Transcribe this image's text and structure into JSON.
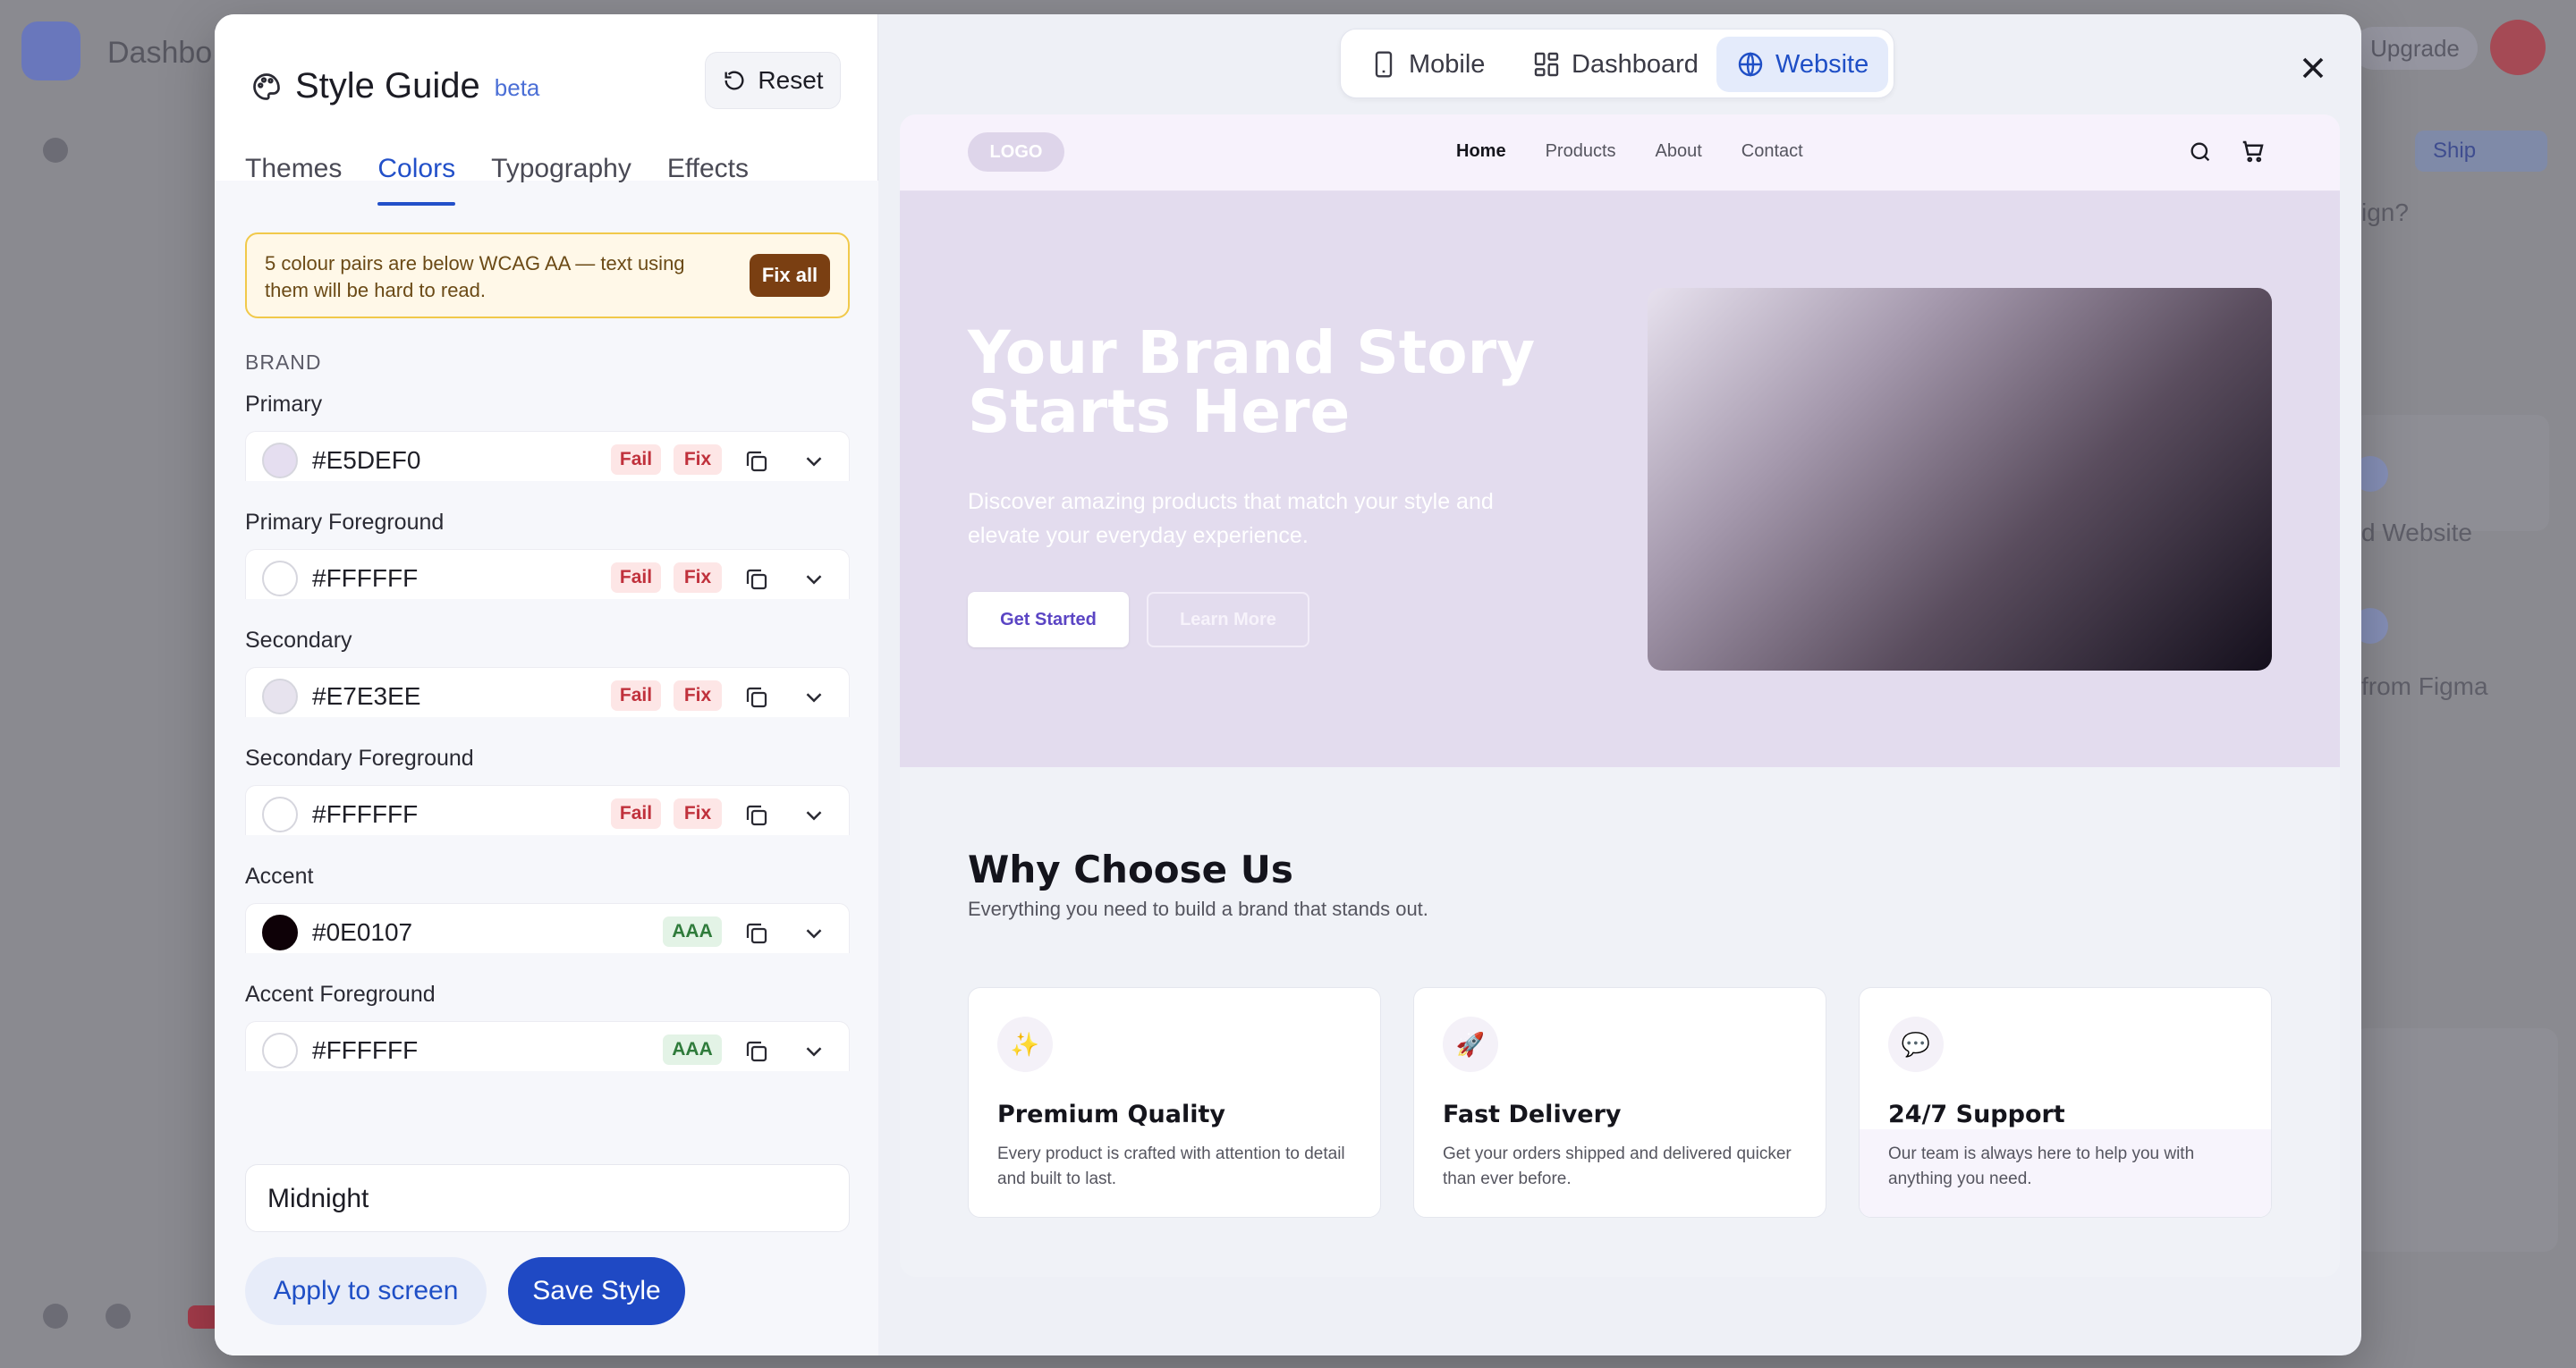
{
  "backdrop": {
    "app_title": "Dashbo",
    "upgrade_label": "Upgrade",
    "pill_label": "Ship",
    "side_text_1": "ign?",
    "side_text_2": "d Website",
    "side_text_3": "from Figma"
  },
  "style_guide": {
    "title": "Style Guide",
    "badge": "beta",
    "reset_label": "Reset",
    "tabs": [
      "Themes",
      "Colors",
      "Typography",
      "Effects"
    ],
    "active_tab": "Colors",
    "warning": {
      "text": "5 colour pairs are below WCAG AA — text using them will be hard to read.",
      "action": "Fix all"
    },
    "section_label": "BRAND",
    "colors": [
      {
        "label": "Primary",
        "hex": "#E5DEF0",
        "badges": [
          "Fail",
          "Fix"
        ]
      },
      {
        "label": "Primary Foreground",
        "hex": "#FFFFFF",
        "badges": [
          "Fail",
          "Fix"
        ]
      },
      {
        "label": "Secondary",
        "hex": "#E7E3EE",
        "badges": [
          "Fail",
          "Fix"
        ]
      },
      {
        "label": "Secondary Foreground",
        "hex": "#FFFFFF",
        "badges": [
          "Fail",
          "Fix"
        ]
      },
      {
        "label": "Accent",
        "hex": "#0E0107",
        "badges": [
          "AAA"
        ]
      },
      {
        "label": "Accent Foreground",
        "hex": "#FFFFFF",
        "badges": [
          "AAA"
        ]
      }
    ],
    "preset_name": "Midnight",
    "apply_label": "Apply to screen",
    "save_label": "Save Style"
  },
  "preview_switcher": {
    "options": [
      {
        "label": "Mobile",
        "icon": "mobile-icon"
      },
      {
        "label": "Dashboard",
        "icon": "dashboard-icon"
      },
      {
        "label": "Website",
        "icon": "globe-icon"
      }
    ],
    "active": "Website"
  },
  "website_preview": {
    "logo": "LOGO",
    "nav_links": [
      "Home",
      "Products",
      "About",
      "Contact"
    ],
    "active_link": "Home",
    "hero": {
      "title": "Your Brand Story Starts Here",
      "subtitle": "Discover amazing products that match your style and elevate your everyday experience.",
      "primary_cta": "Get Started",
      "secondary_cta": "Learn More"
    },
    "why": {
      "title": "Why Choose Us",
      "subtitle": "Everything you need to build a brand that stands out."
    },
    "features": [
      {
        "icon": "✨",
        "title": "Premium Quality",
        "desc": "Every product is crafted with attention to detail and built to last."
      },
      {
        "icon": "🚀",
        "title": "Fast Delivery",
        "desc": "Get your orders shipped and delivered quicker than ever before."
      },
      {
        "icon": "💬",
        "title": "24/7 Support",
        "desc": "Our team is always here to help you with anything you need."
      }
    ]
  },
  "colors": {
    "accent": "#1F49C4",
    "warning_border": "#F1C94A",
    "fix_all_bg": "#7A3F12",
    "fail_text": "#C0313C",
    "aaa_text": "#2F7B3B"
  }
}
